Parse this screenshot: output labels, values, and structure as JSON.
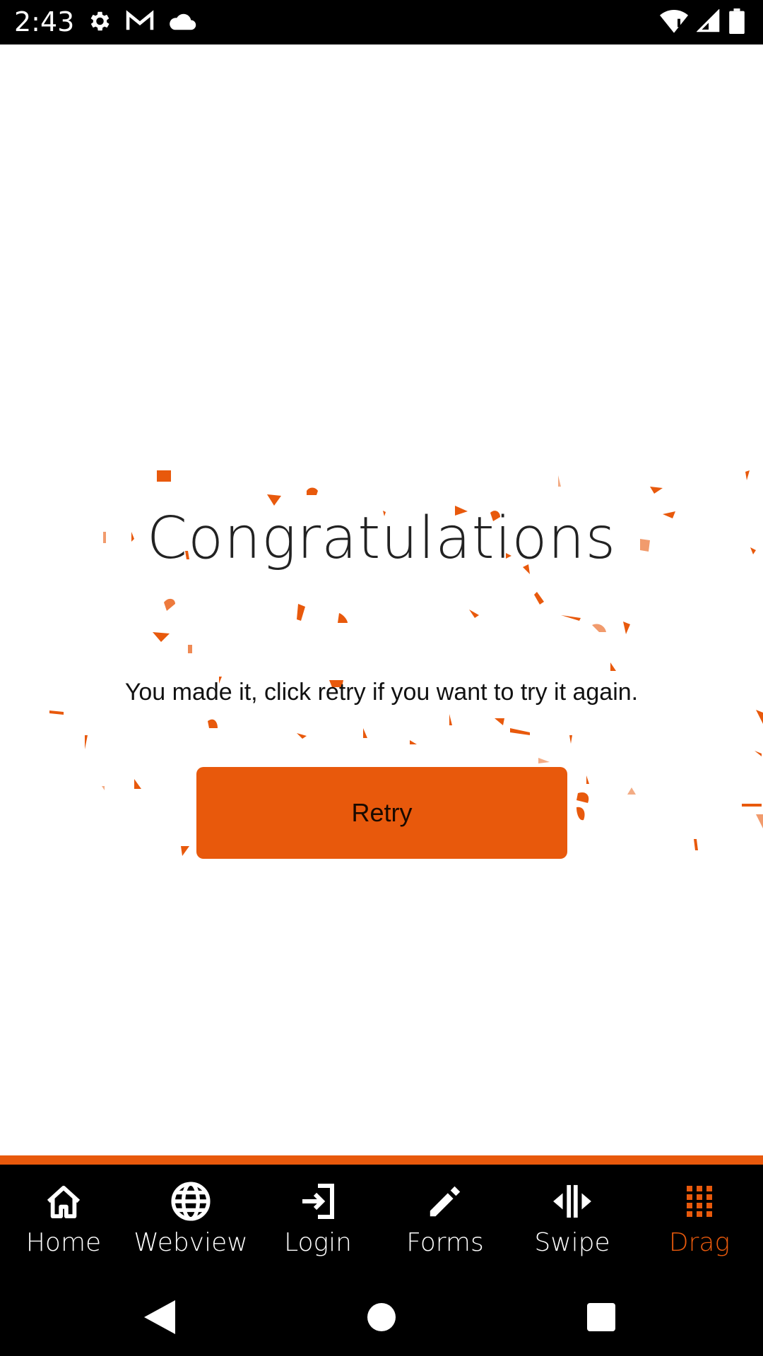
{
  "status_bar": {
    "time": "2:43",
    "left_icons": [
      "settings-icon",
      "gmail-icon",
      "cloud-icon"
    ],
    "right_icons": [
      "wifi-icon",
      "signal-icon",
      "battery-icon"
    ]
  },
  "main": {
    "title": "Congratulations",
    "message": "You made it, click retry if you want to try it again.",
    "retry_label": "Retry"
  },
  "tabs": [
    {
      "label": "Home",
      "icon": "home-icon",
      "active": false
    },
    {
      "label": "Webview",
      "icon": "globe-icon",
      "active": false
    },
    {
      "label": "Login",
      "icon": "login-icon",
      "active": false
    },
    {
      "label": "Forms",
      "icon": "pencil-icon",
      "active": false
    },
    {
      "label": "Swipe",
      "icon": "swipe-icon",
      "active": false
    },
    {
      "label": "Drag",
      "icon": "grid-icon",
      "active": true
    }
  ],
  "colors": {
    "accent": "#e8590c",
    "background": "#ffffff",
    "bar": "#000000"
  }
}
